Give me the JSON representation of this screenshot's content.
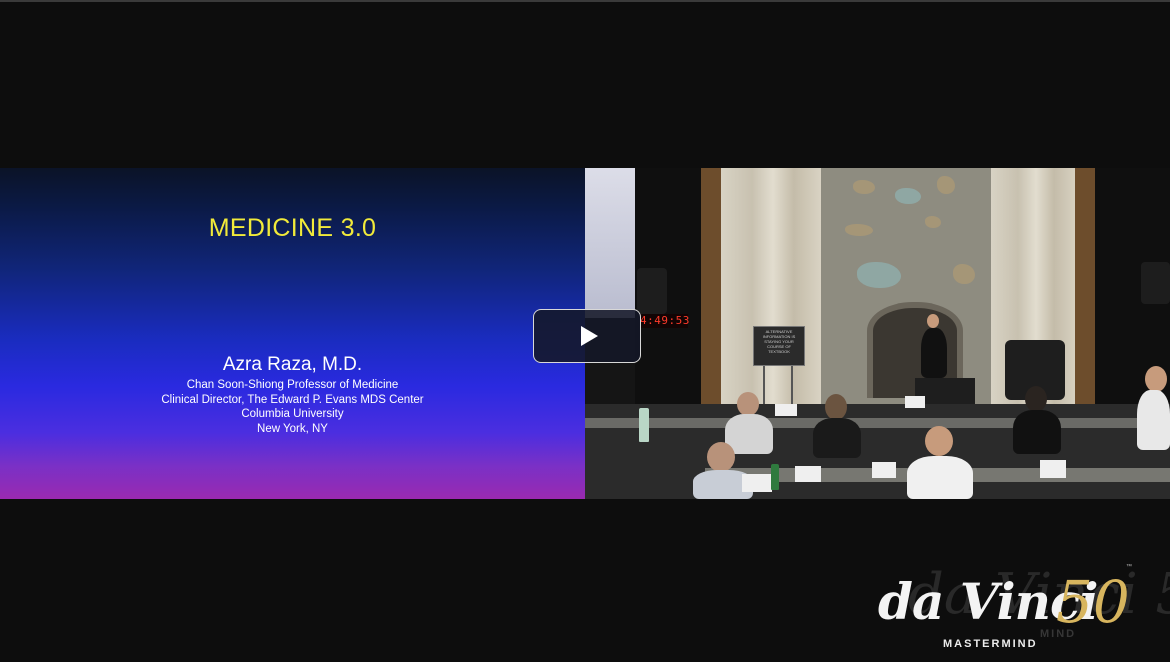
{
  "slide": {
    "title": "MEDICINE 3.0",
    "presenter_name": "Azra Raza, M.D.",
    "presenter_title": "Chan Soon-Shiong Professor of Medicine",
    "presenter_role": "Clinical Director, The Edward P. Evans MDS Center",
    "institution": "Columbia University",
    "location": "New York, NY",
    "title_color": "#f1ea3a"
  },
  "room": {
    "timer": "4:49:53",
    "sign_text": "ALTERNATIVE INFORMATION IS STAYING YOUR COURSE OF TEXTBOOK"
  },
  "player": {
    "play_icon": "play-icon"
  },
  "logo": {
    "script": "da Vinci",
    "number": "50",
    "subtitle": "MASTERMIND",
    "tm": "™",
    "accent_color": "#d7b55e"
  }
}
